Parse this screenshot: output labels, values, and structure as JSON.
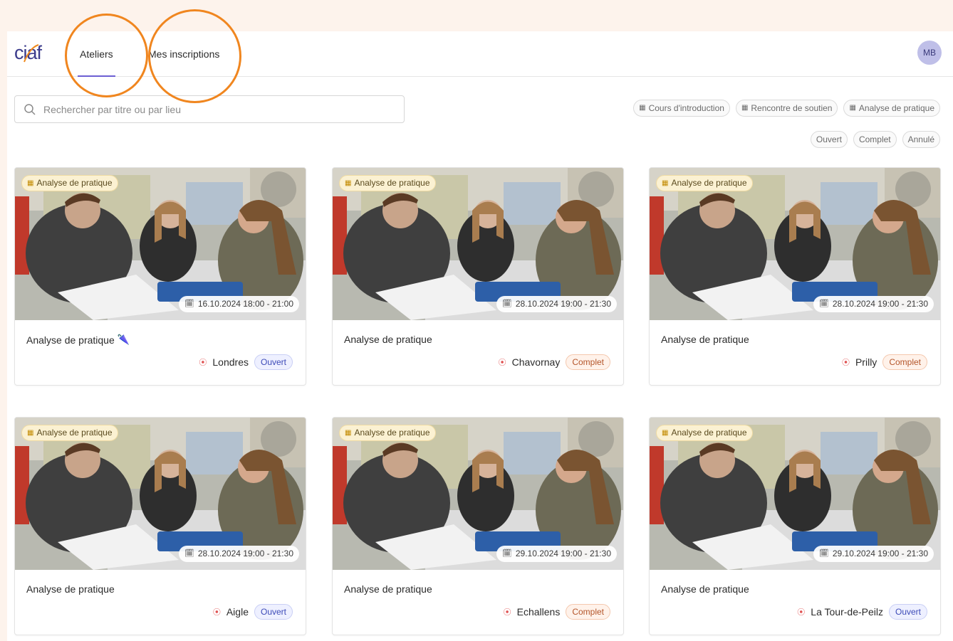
{
  "header": {
    "tabs": [
      {
        "label": "Ateliers",
        "active": true
      },
      {
        "label": "Mes inscriptions",
        "active": false
      }
    ],
    "avatar_initials": "MB"
  },
  "search": {
    "placeholder": "Rechercher par titre ou par lieu",
    "value": ""
  },
  "type_filters": [
    "Cours d'introduction",
    "Rencontre de soutien",
    "Analyse de pratique"
  ],
  "status_filters": [
    "Ouvert",
    "Complet",
    "Annulé"
  ],
  "colors": {
    "accent": "#6c5fd3",
    "annotation_circle": "#f0861f",
    "open": "#3d4bb8",
    "full": "#b4552a"
  },
  "cards": [
    {
      "tag": "Analyse de pratique",
      "date": "16.10.2024 18:00 - 21:00",
      "title": "Analyse de pratique",
      "emoji": "🌂",
      "place": "Londres",
      "status": "Ouvert",
      "status_kind": "open"
    },
    {
      "tag": "Analyse de pratique",
      "date": "28.10.2024 19:00 - 21:30",
      "title": "Analyse de pratique",
      "emoji": "",
      "place": "Chavornay",
      "status": "Complet",
      "status_kind": "full"
    },
    {
      "tag": "Analyse de pratique",
      "date": "28.10.2024 19:00 - 21:30",
      "title": "Analyse de pratique",
      "emoji": "",
      "place": "Prilly",
      "status": "Complet",
      "status_kind": "full"
    },
    {
      "tag": "Analyse de pratique",
      "date": "28.10.2024 19:00 - 21:30",
      "title": "Analyse de pratique",
      "emoji": "",
      "place": "Aigle",
      "status": "Ouvert",
      "status_kind": "open"
    },
    {
      "tag": "Analyse de pratique",
      "date": "29.10.2024 19:00 - 21:30",
      "title": "Analyse de pratique",
      "emoji": "",
      "place": "Echallens",
      "status": "Complet",
      "status_kind": "full"
    },
    {
      "tag": "Analyse de pratique",
      "date": "29.10.2024 19:00 - 21:30",
      "title": "Analyse de pratique",
      "emoji": "",
      "place": "La Tour-de-Peilz",
      "status": "Ouvert",
      "status_kind": "open"
    }
  ]
}
